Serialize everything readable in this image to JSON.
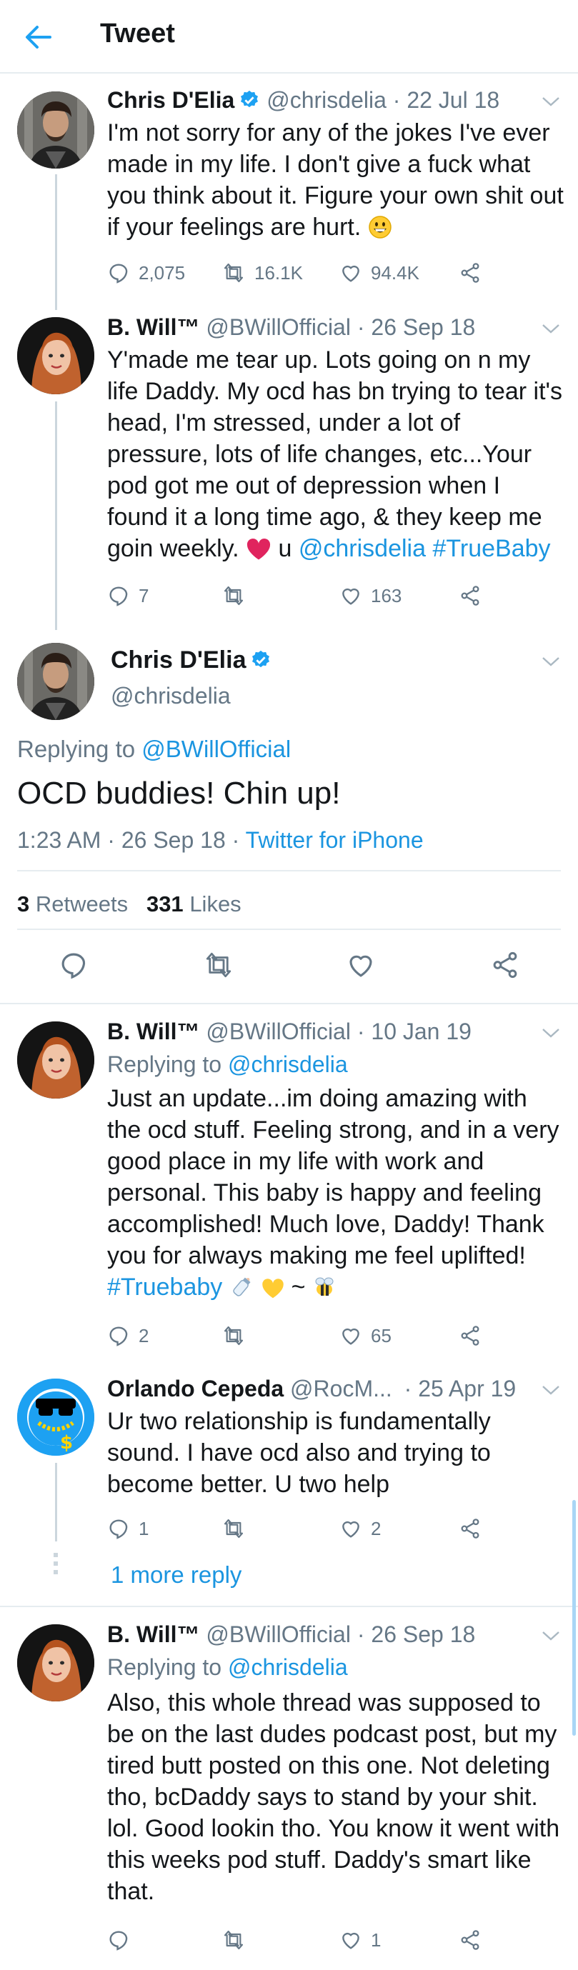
{
  "header": {
    "title": "Tweet"
  },
  "tweets": [
    {
      "name": "Chris D'Elia",
      "handle": "@chrisdelia",
      "date": "· 22 Jul 18",
      "text": "I'm not sorry for any of the jokes I've ever made in my life. I don't give a fuck what you think about it. Figure your own shit out if your feelings are hurt.",
      "replies": "2,075",
      "retweets": "16.1K",
      "likes": "94.4K"
    },
    {
      "name": "B. Will™",
      "handle": "@BWillOfficial",
      "date": "· 26 Sep 18",
      "text": "Y'made me tear up. Lots going on n my life Daddy. My ocd has bn trying to tear it's head, I'm stressed, under a lot of pressure, lots of life changes, etc...Your pod got me out of depression when I found it a long time ago, & they keep me goin weekly.",
      "text_u": "u",
      "mention": "@chrisdelia",
      "hashtag": "#TrueBaby",
      "replies": "7",
      "likes": "163"
    },
    {
      "name": "B. Will™",
      "handle": "@BWillOfficial",
      "date": "· 10 Jan 19",
      "replying_label": "Replying to",
      "replying_to": "@chrisdelia",
      "text": "Just an update...im doing amazing with the ocd stuff. Feeling strong, and in a very good place in my life with work and personal. This baby is happy and feeling accomplished! Much love, Daddy! Thank you for always making me feel uplifted!",
      "hashtag": "#Truebaby",
      "tilde": "~",
      "replies": "2",
      "likes": "65"
    },
    {
      "name": "Orlando Cepeda",
      "handle": "@RocM...",
      "date": "· 25 Apr 19",
      "text": "Ur two relationship is fundamentally sound. I have ocd also and trying to become better. U two help",
      "replies": "1",
      "likes": "2"
    },
    {
      "name": "B. Will™",
      "handle": "@BWillOfficial",
      "date": "· 26 Sep 18",
      "replying_label": "Replying to",
      "replying_to": "@chrisdelia",
      "text": "Also, this whole thread was supposed to be on the last dudes podcast post, but my tired butt posted on this one. Not deleting tho, bcDaddy says to stand by your shit. lol. Good lookin tho. You know it went with this weeks pod stuff. Daddy's smart like that.",
      "likes": "1"
    }
  ],
  "focused": {
    "name": "Chris D'Elia",
    "handle": "@chrisdelia",
    "replying_label": "Replying to",
    "replying_to": "@BWillOfficial",
    "text": "OCD buddies! Chin up!",
    "timestamp": "1:23 AM · 26 Sep 18 ·",
    "source": "Twitter for iPhone",
    "retweets_count": "3",
    "retweets_label": "Retweets",
    "likes_count": "331",
    "likes_label": "Likes"
  },
  "more_replies": "1 more reply",
  "colors": {
    "accent": "#1b95e0",
    "grey": "#657786",
    "verified": "#1da1f2",
    "heart": "#e0245e"
  }
}
